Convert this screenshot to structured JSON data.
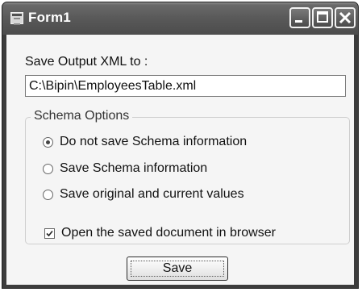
{
  "window": {
    "title": "Form1",
    "icon": "form-app-icon",
    "controls": [
      "minimize-icon",
      "maximize-icon",
      "close-icon"
    ]
  },
  "form": {
    "output_label": "Save Output XML to :",
    "output_path": "C:\\Bipin\\EmployeesTable.xml",
    "schema_group": {
      "legend": "Schema Options",
      "options": [
        {
          "label": "Do not save Schema information",
          "checked": true
        },
        {
          "label": "Save Schema information",
          "checked": false
        },
        {
          "label": "Save original and current values",
          "checked": false
        }
      ]
    },
    "open_in_browser": {
      "label": "Open the saved document in browser",
      "checked": true
    },
    "save_button": "Save"
  }
}
